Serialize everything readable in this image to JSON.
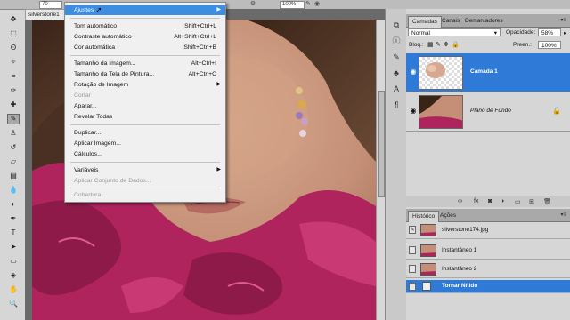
{
  "options_bar": {
    "field_left": "70",
    "field_right": "100%"
  },
  "document": {
    "tab_title": "silverstone1"
  },
  "menu": {
    "items": [
      {
        "label": "Ajustes",
        "shortcut": "",
        "submenu": true,
        "highlighted": true,
        "disabled": false
      },
      {
        "label": "Tom automático",
        "shortcut": "Shift+Ctrl+L",
        "submenu": false,
        "disabled": false
      },
      {
        "label": "Contraste automático",
        "shortcut": "Alt+Shift+Ctrl+L",
        "submenu": false,
        "disabled": false
      },
      {
        "label": "Cor automática",
        "shortcut": "Shift+Ctrl+B",
        "submenu": false,
        "disabled": false
      },
      {
        "label": "Tamanho da Imagem...",
        "shortcut": "Alt+Ctrl+I",
        "submenu": false,
        "disabled": false
      },
      {
        "label": "Tamanho da Tela de Pintura...",
        "shortcut": "Alt+Ctrl+C",
        "submenu": false,
        "disabled": false
      },
      {
        "label": "Rotação de Imagem",
        "shortcut": "",
        "submenu": true,
        "disabled": false
      },
      {
        "label": "Cortar",
        "shortcut": "",
        "submenu": false,
        "disabled": true
      },
      {
        "label": "Aparar...",
        "shortcut": "",
        "submenu": false,
        "disabled": false
      },
      {
        "label": "Revelar Todas",
        "shortcut": "",
        "submenu": false,
        "disabled": false
      },
      {
        "label": "Duplicar...",
        "shortcut": "",
        "submenu": false,
        "disabled": false
      },
      {
        "label": "Aplicar Imagem...",
        "shortcut": "",
        "submenu": false,
        "disabled": false
      },
      {
        "label": "Cálculos...",
        "shortcut": "",
        "submenu": false,
        "disabled": false
      },
      {
        "label": "Variáveis",
        "shortcut": "",
        "submenu": true,
        "disabled": false
      },
      {
        "label": "Aplicar Conjunto de Dados...",
        "shortcut": "",
        "submenu": false,
        "disabled": true
      },
      {
        "label": "Cobertura...",
        "shortcut": "",
        "submenu": false,
        "disabled": true
      }
    ]
  },
  "layers_panel": {
    "tabs": [
      "Camadas",
      "Canais",
      "Demarcadores"
    ],
    "blend_mode": "Normal",
    "opacity_label": "Opacidade:",
    "opacity_value": "58%",
    "lock_label": "Bloq.:",
    "fill_label": "Preen.:",
    "fill_value": "100%",
    "layers": [
      {
        "name": "Camada 1",
        "selected": true
      },
      {
        "name": "Plano de Fundo",
        "selected": false,
        "locked": true
      }
    ]
  },
  "history_panel": {
    "tabs": [
      "Histórico",
      "Ações"
    ],
    "items": [
      {
        "label": "silverstone174.jpg",
        "selected": false
      },
      {
        "label": "Instantâneo 1",
        "selected": false
      },
      {
        "label": "Instantâneo 2",
        "selected": false
      },
      {
        "label": "Tornar Nítido",
        "selected": true
      }
    ]
  },
  "colors": {
    "selection_blue": "#2f7ad6",
    "menu_highlight": "#3d8ee0",
    "scarf": "#b0245e"
  }
}
